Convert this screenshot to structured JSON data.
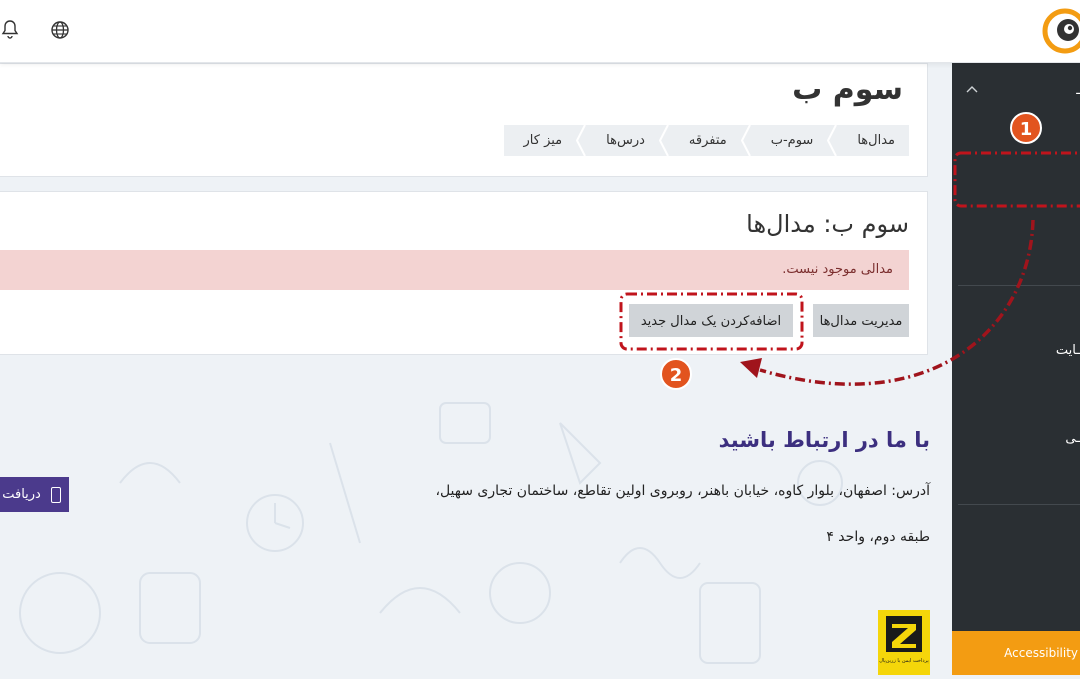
{
  "main": {
    "page_title": "سوم ب",
    "breadcrumb": [
      "میز کار",
      "درس‌ها",
      "متفرقه",
      "سوم-ب",
      "مدال‌ها"
    ],
    "section_title": "سوم ب: مدال‌ها",
    "alert_text": "مدالی موجود نیست.",
    "manage_button": "مدیریت مدال‌ها",
    "add_button": "اضافه‌کردن یک مدال جدید"
  },
  "footer": {
    "title": "با ما در ارتباط باشید",
    "address_line1": "آدرس: اصفهان، بلوار کاوه، خیابان باهنر، روبروی اولین تقاطع، ساختمان تجاری سهیل،",
    "address_line2": "طبقه دوم، واحد ۴",
    "download_button": "دریافت",
    "badge_text": "پرداخت ایمن با زرین‌پال"
  },
  "sidebar": {
    "item_a": "ـایت",
    "item_b": "ـی",
    "accessibility": "Accessibility"
  },
  "annotations": {
    "step1": "1",
    "step2": "2",
    "marker_color": "#c0141c",
    "circle_color": "#e2541f"
  },
  "colors": {
    "sidebar_bg": "#2a2f33",
    "accent_orange": "#f39c12",
    "brand_purple": "#4b3a8c",
    "alert_bg": "#f3d3d2"
  },
  "icons": [
    "bell-icon",
    "globe-icon",
    "logo-icon",
    "chevron-up-icon",
    "mobile-icon"
  ]
}
